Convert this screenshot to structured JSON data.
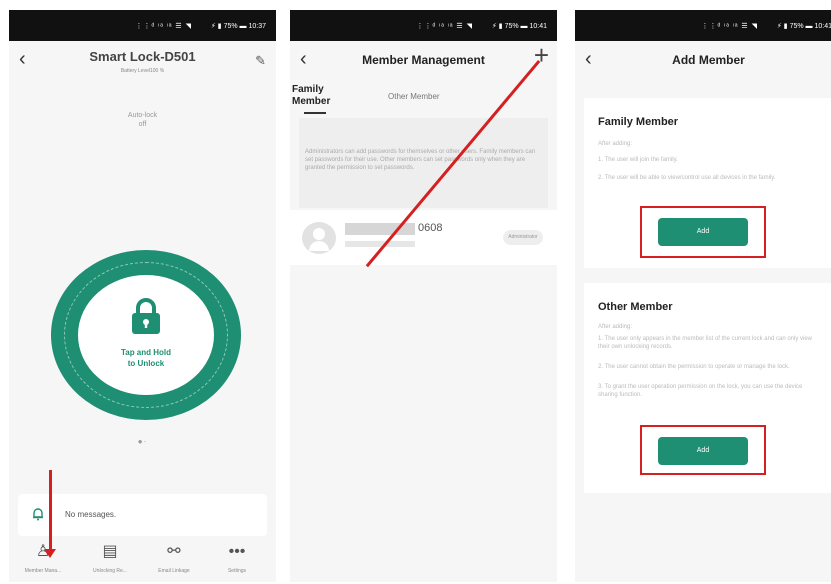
{
  "colors": {
    "accent": "#1f8f73",
    "highlight": "#d42020",
    "statusbar": "#111111"
  },
  "statusbar": {
    "signal": "⋮⋮ᵈ ᶦᵃ ᶦᵃ ☰ ◥",
    "battery": "⚡ ▮ 75% ▬ 10:37",
    "battery_p2": "⚡ ▮ 75% ▬ 10:41",
    "battery_p3": "⚡ ▮ 75% ▬ 10:41"
  },
  "screen1": {
    "back_icon": "chevron-left",
    "title": "Smart Lock-D501",
    "subtitle": "Battery Level100 %",
    "auto_lock_label": "Auto-lock",
    "auto_lock_value": "off",
    "unlock_text_line1": "Tap and Hold",
    "unlock_text_line2": "to Unlock",
    "pager": "●·",
    "message": "No messages.",
    "tabs": [
      {
        "label": "Member Mana...",
        "icon": "person-icon"
      },
      {
        "label": "Unlocking Re...",
        "icon": "record-icon"
      },
      {
        "label": "Email Linkage",
        "icon": "link-icon"
      },
      {
        "label": "Settings",
        "icon": "dots-icon"
      }
    ]
  },
  "screen2": {
    "title": "Member Management",
    "tab_family": "Family Member",
    "tab_other": "Other Member",
    "info_text": "Administrators can add passwords for themselves or other users. Family members can set passwords for their use. Other members can set passwords only when they are granted the permission to set passwords.",
    "member_name_suffix": "0608",
    "member_badge": "Administrator"
  },
  "screen3": {
    "title": "Add Member",
    "family_title": "Family Member",
    "family_desc_heading": "After adding:",
    "family_desc_1": "1. The user will join the family.",
    "family_desc_2": "2. The user will be able to view/control use all devices in the family.",
    "add_label": "Add",
    "other_title": "Other Member",
    "other_desc_heading": "After adding:",
    "other_desc_1": "1. The user only appears in the member list of the current lock and can only view their own unlocking records.",
    "other_desc_2": "2. The user cannot obtain the permission to operate or manage the lock.",
    "other_desc_3": "3. To grant the user operation permission on the lock, you can use the device sharing function."
  }
}
